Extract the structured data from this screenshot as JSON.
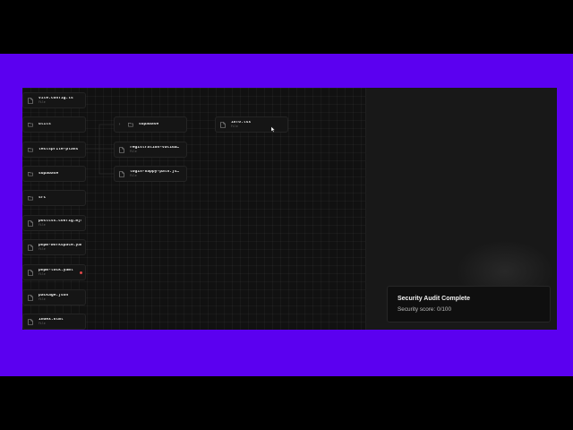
{
  "files_column": [
    {
      "name": "vite.config.ts",
      "sub": "File",
      "kind": "file",
      "icon": "file-icon"
    },
    {
      "name": "utils",
      "sub": "",
      "kind": "folder",
      "icon": "folder-icon"
    },
    {
      "name": "testsprite-plans",
      "sub": "",
      "kind": "folder",
      "icon": "folder-icon"
    },
    {
      "name": "supabase",
      "sub": "",
      "kind": "folder",
      "icon": "folder-icon"
    },
    {
      "name": "src",
      "sub": "",
      "kind": "folder",
      "icon": "folder-icon"
    },
    {
      "name": "postcss.config.mjs",
      "sub": "File",
      "kind": "file",
      "icon": "file-icon"
    },
    {
      "name": "pnpm-workspace.yaml",
      "sub": "File",
      "kind": "file",
      "icon": "file-icon"
    },
    {
      "name": "pnpm-lock.yaml",
      "sub": "File",
      "kind": "file",
      "icon": "file-icon",
      "badge": true
    },
    {
      "name": "package.json",
      "sub": "File",
      "kind": "file",
      "icon": "file-icon"
    },
    {
      "name": "index.html",
      "sub": "File",
      "kind": "file",
      "icon": "file-icon"
    }
  ],
  "second_column": [
    {
      "name": "supabase",
      "sub": "",
      "kind": "folder",
      "icon": "folder-icon",
      "expanded": true
    },
    {
      "name": "registration-valida…",
      "sub": "File",
      "kind": "file",
      "icon": "file-icon"
    },
    {
      "name": "login-happy-path.js…",
      "sub": "File",
      "kind": "file",
      "icon": "file-icon"
    }
  ],
  "third_column": [
    {
      "name": "info.tsx",
      "sub": "File",
      "kind": "file",
      "icon": "file-icon"
    }
  ],
  "toast": {
    "title": "Security Audit Complete",
    "description": "Security score: 0/100"
  },
  "colors": {
    "band": "#5b00f0",
    "canvas": "#111111",
    "panel": "#181818",
    "badge": "#e0484a"
  }
}
